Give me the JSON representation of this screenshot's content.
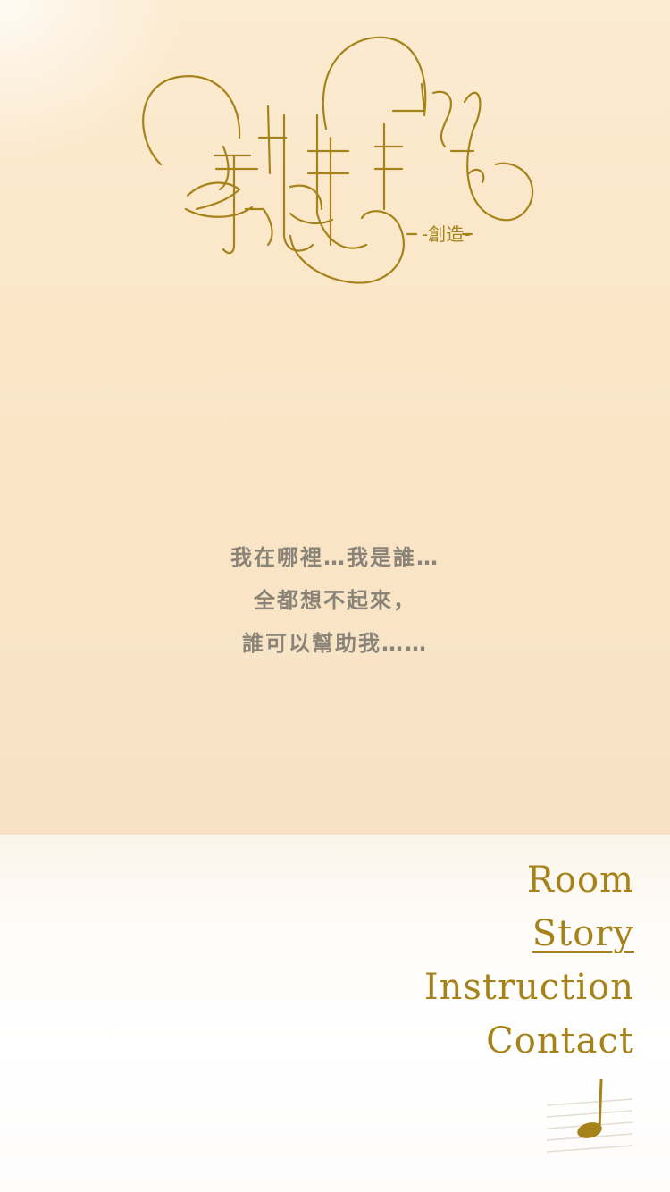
{
  "logo": {
    "icon": "calligraphy-title-logo",
    "subtitle": "-創造-",
    "color": "#a6831a"
  },
  "story": {
    "lines": [
      "我在哪裡…我是誰…",
      "全都想不起來，",
      "誰可以幫助我……"
    ],
    "color": "#8a8478"
  },
  "menu": {
    "items": [
      {
        "label": "Room",
        "active": false
      },
      {
        "label": "Story",
        "active": true
      },
      {
        "label": "Instruction",
        "active": false
      },
      {
        "label": "Contact",
        "active": false
      }
    ],
    "color": "#a6831a"
  },
  "music_toggle": {
    "icon": "music-note-icon"
  }
}
